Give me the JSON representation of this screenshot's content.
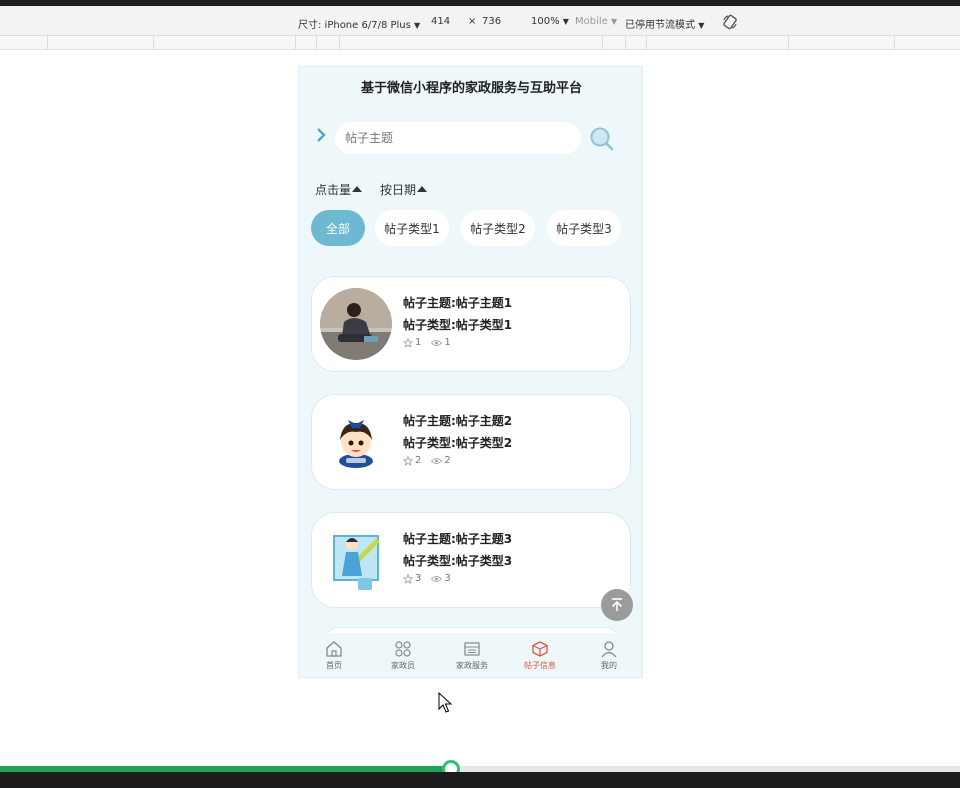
{
  "devtools": {
    "device_label": "尺寸: iPhone 6/7/8 Plus",
    "width": "414",
    "times": "×",
    "height": "736",
    "zoom": "100%",
    "mode": "Mobile",
    "throttle": "已停用节流模式"
  },
  "app": {
    "title": "基于微信小程序的家政服务与互助平台",
    "search_placeholder": "帖子主题",
    "sort": [
      {
        "label": "点击量"
      },
      {
        "label": "按日期"
      }
    ],
    "chips": [
      {
        "label": "全部",
        "active": true
      },
      {
        "label": "帖子类型1",
        "active": false
      },
      {
        "label": "帖子类型2",
        "active": false
      },
      {
        "label": "帖子类型3",
        "active": false
      }
    ],
    "posts": [
      {
        "subject": "帖子主题:帖子主题1",
        "type": "帖子类型:帖子类型1",
        "stars": "1",
        "views": "1",
        "image": "woman-cleaning-floor"
      },
      {
        "subject": "帖子主题:帖子主题2",
        "type": "帖子类型:帖子类型2",
        "stars": "2",
        "views": "2",
        "image": "cartoon-girl-logo"
      },
      {
        "subject": "帖子主题:帖子主题3",
        "type": "帖子类型:帖子类型3",
        "stars": "3",
        "views": "3",
        "image": "cartoon-cleaner-with-mop"
      }
    ],
    "tabs": [
      {
        "label": "首页",
        "icon": "home-icon",
        "active": false
      },
      {
        "label": "家政员",
        "icon": "grid-icon",
        "active": false
      },
      {
        "label": "家政服务",
        "icon": "calendar-icon",
        "active": false
      },
      {
        "label": "帖子信息",
        "icon": "box-icon",
        "active": true
      },
      {
        "label": "我的",
        "icon": "user-icon",
        "active": false
      }
    ]
  },
  "video_progress": 0.47,
  "colors": {
    "accent": "#6cb9d1",
    "tab_active": "#e0533d",
    "progress": "#23a05a",
    "background": "#eef8fb"
  }
}
